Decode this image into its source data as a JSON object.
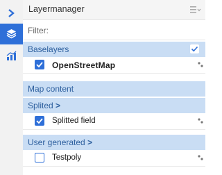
{
  "panel": {
    "title": "Layermanager"
  },
  "filter": {
    "placeholder": "Filter:",
    "value": ""
  },
  "groups": {
    "baselayers": {
      "label": "Baselayers",
      "layer": {
        "label": "OpenStreetMap",
        "checked": true
      }
    },
    "map_content": {
      "label": "Map content"
    },
    "splited": {
      "label": "Splited",
      "chevron": ">",
      "layer": {
        "label": "Splitted field",
        "checked": true
      }
    },
    "user_generated": {
      "label": "User generated",
      "chevron": ">",
      "layer": {
        "label": "Testpoly",
        "checked": false
      }
    }
  },
  "icons": {
    "rail": [
      "chevron-right-icon",
      "layers-icon",
      "chart-icon"
    ],
    "header": "menu-icon",
    "row_end": "settings-icon"
  },
  "colors": {
    "accent": "#2e6fd8",
    "band": "#c9ddf4",
    "band_text": "#2d5f9e"
  }
}
